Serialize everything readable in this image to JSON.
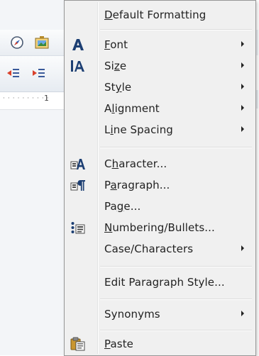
{
  "menu": {
    "items": [
      {
        "label": "Default Formatting",
        "mnemonic": "D"
      },
      {
        "label": "Font",
        "mnemonic": "F",
        "icon": "font-icon",
        "submenu": true
      },
      {
        "label": "Size",
        "mnemonic": "z",
        "icon": "font-size-icon",
        "submenu": true
      },
      {
        "label": "Style",
        "mnemonic": "y",
        "submenu": true
      },
      {
        "label": "Alignment",
        "mnemonic": "l",
        "submenu": true
      },
      {
        "label": "Line Spacing",
        "mnemonic": "i",
        "submenu": true
      },
      {
        "label": "Character...",
        "mnemonic": "h",
        "icon": "character-icon"
      },
      {
        "label": "Paragraph...",
        "mnemonic": "a",
        "icon": "paragraph-icon"
      },
      {
        "label": "Page...",
        "mnemonic": "g"
      },
      {
        "label": "Numbering/Bullets...",
        "mnemonic": "N",
        "icon": "numbering-bullets-icon"
      },
      {
        "label": "Case/Characters",
        "submenu": true
      },
      {
        "label": "Edit Paragraph Style..."
      },
      {
        "label": "Synonyms",
        "submenu": true
      },
      {
        "label": "Paste",
        "mnemonic": "P",
        "icon": "paste-icon"
      }
    ]
  },
  "ruler": {
    "mark": "1"
  }
}
